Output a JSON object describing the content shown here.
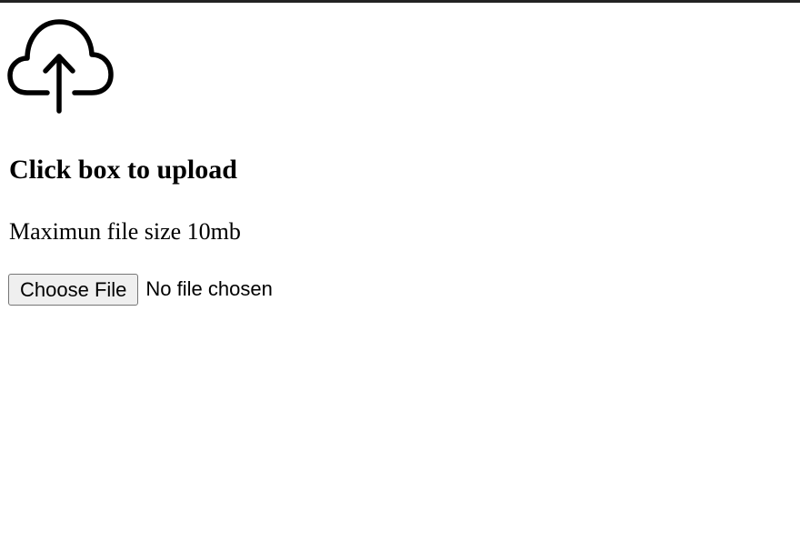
{
  "upload": {
    "icon": "cloud-upload-icon",
    "title": "Click box to upload",
    "subtitle": "Maximun file size 10mb",
    "button_label": "Choose File",
    "file_status": "No file chosen"
  }
}
